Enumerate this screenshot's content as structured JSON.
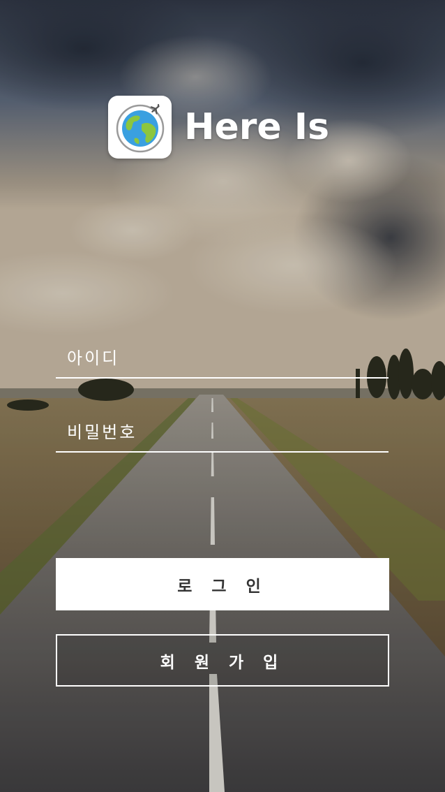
{
  "app": {
    "name": "Here Is",
    "icon": "globe-airplane-icon"
  },
  "login_form": {
    "id_placeholder": "아이디",
    "id_value": "",
    "password_placeholder": "비밀번호",
    "password_value": ""
  },
  "buttons": {
    "login_label": "로 그 인",
    "signup_label": "회 원 가 입"
  },
  "colors": {
    "button_fill": "#ffffff",
    "button_text_dark": "#333333",
    "text_light": "#ffffff",
    "globe_ocean": "#3aa0e0",
    "globe_land": "#8cc63f"
  }
}
